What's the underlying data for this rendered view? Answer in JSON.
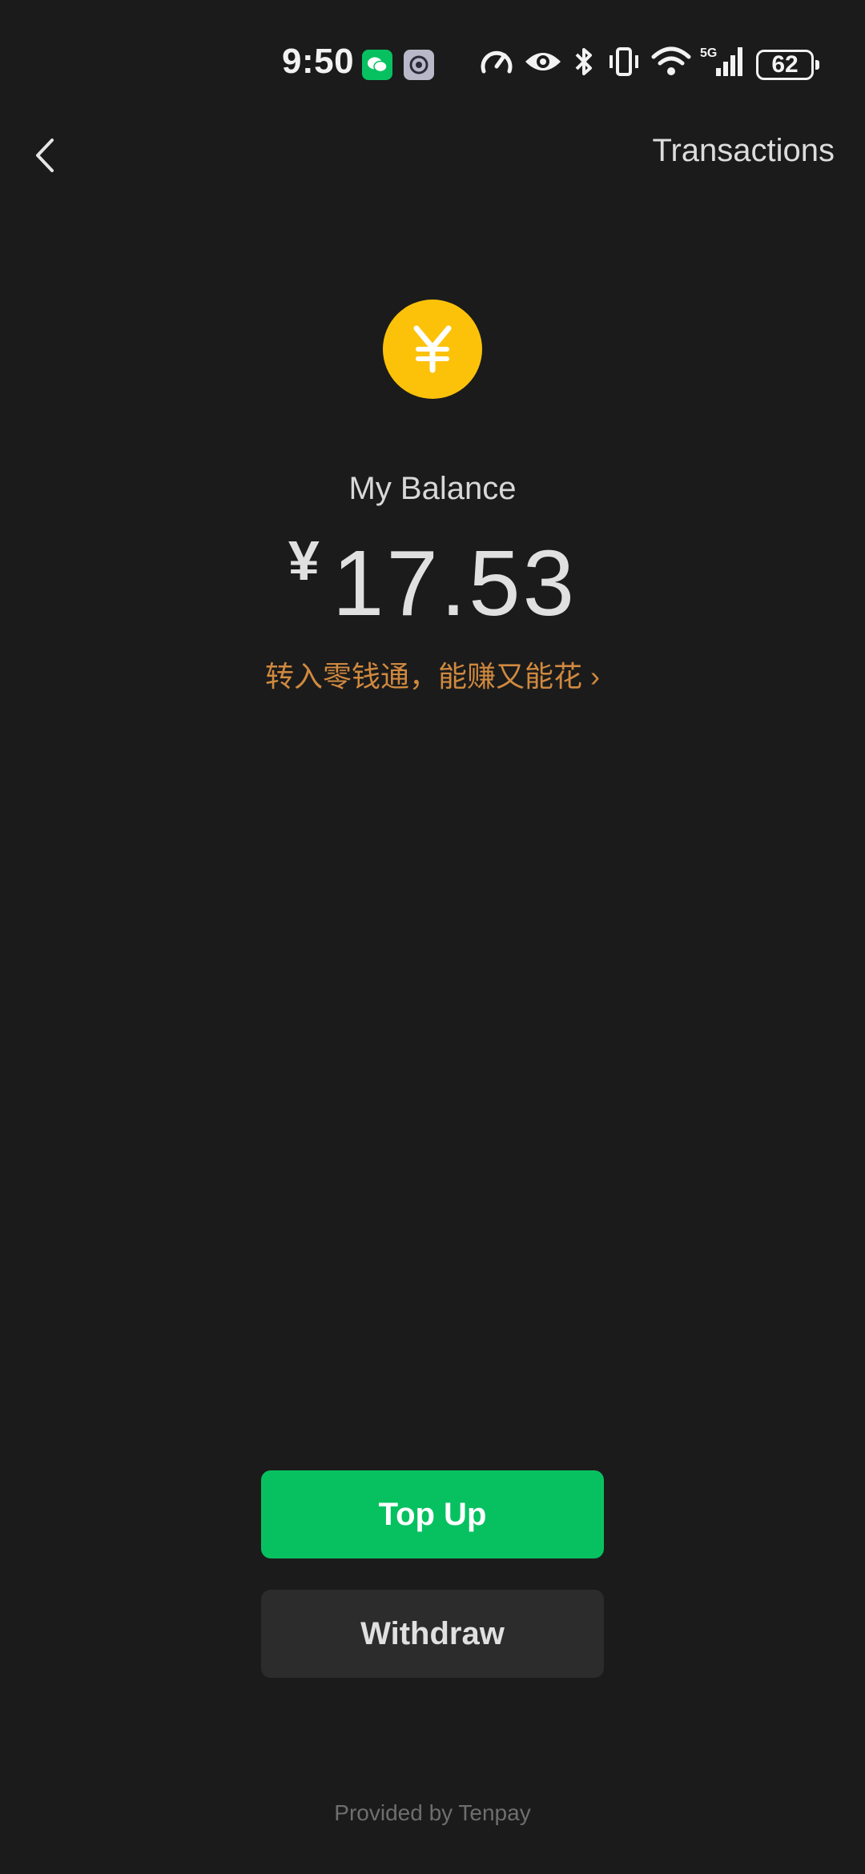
{
  "status_bar": {
    "time": "9:50",
    "battery": "62",
    "network": "5G",
    "icons": [
      "wechat-icon",
      "settings-icon",
      "speedometer-icon",
      "eye-icon",
      "bluetooth-icon",
      "vibrate-icon",
      "wifi-icon",
      "signal-icon",
      "battery-icon"
    ]
  },
  "nav": {
    "back_icon": "chevron-left-icon",
    "transactions_label": "Transactions"
  },
  "balance": {
    "coin_symbol": "¥",
    "label": "My Balance",
    "currency": "¥",
    "amount": "17.53",
    "promo_text": "转入零钱通，能赚又能花",
    "promo_chevron": "›"
  },
  "actions": {
    "topup_label": "Top Up",
    "withdraw_label": "Withdraw"
  },
  "footer": {
    "provider_text": "Provided by Tenpay"
  },
  "colors": {
    "background": "#1b1b1b",
    "accent_green": "#07c160",
    "coin_yellow": "#fcc20a",
    "promo_orange": "#d0893f"
  }
}
